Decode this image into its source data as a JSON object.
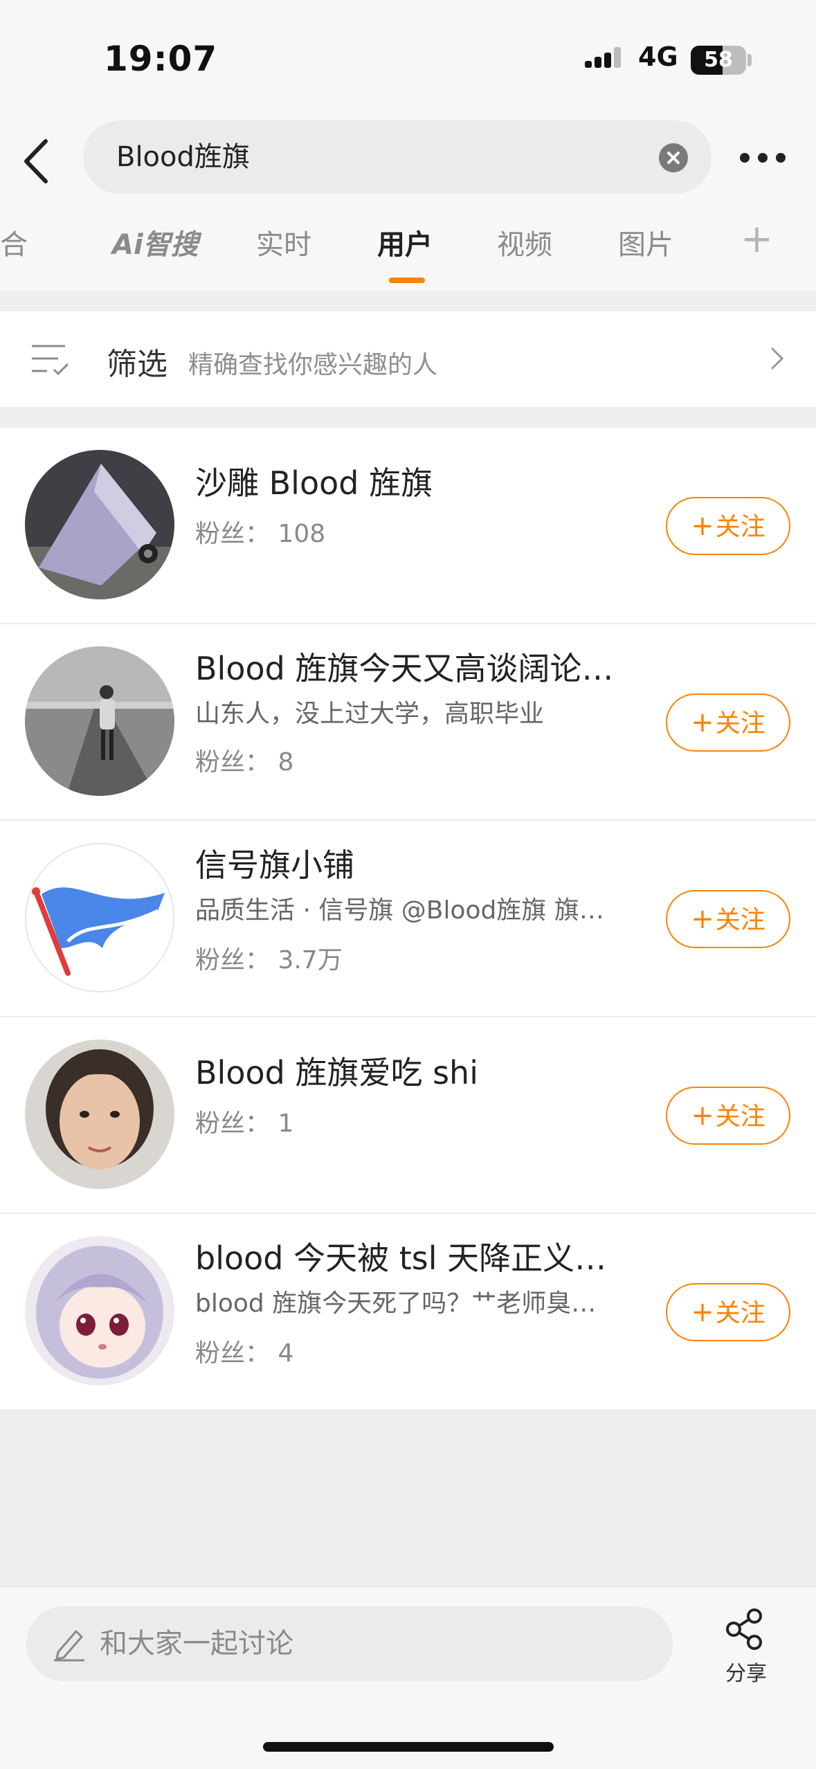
{
  "status_bar": {
    "time": "19:07",
    "network": "4G",
    "battery": "58",
    "battery_level": 0.58
  },
  "search": {
    "query": "Blood旌旗"
  },
  "tabs": [
    {
      "label": "综合",
      "active": false
    },
    {
      "label": "Ai智搜",
      "active": false
    },
    {
      "label": "实时",
      "active": false
    },
    {
      "label": "用户",
      "active": true
    },
    {
      "label": "视频",
      "active": false
    },
    {
      "label": "图片",
      "active": false
    }
  ],
  "tab_add": "+",
  "filter": {
    "label": "筛选",
    "hint": "精确查找你感兴趣的人"
  },
  "users": [
    {
      "name": "沙雕 Blood 旌旗",
      "desc": "",
      "fans": "粉丝： 108",
      "follow": "关注"
    },
    {
      "name": "Blood 旌旗今天又高谈阔论…",
      "desc": "山东人，没上过大学，高职毕业",
      "fans": "粉丝： 8",
      "follow": "关注"
    },
    {
      "name": "信号旗小铺",
      "desc": "品质生活 · 信号旗 @Blood旌旗 旗…",
      "fans": "粉丝： 3.7万",
      "follow": "关注"
    },
    {
      "name": "Blood 旌旗爱吃 shi",
      "desc": "",
      "fans": "粉丝： 1",
      "follow": "关注"
    },
    {
      "name": "blood 今天被 tsl 天降正义了吗",
      "desc": "blood 旌旗今天死了吗？艹老师臭…",
      "fans": "粉丝： 4",
      "follow": "关注"
    }
  ],
  "bottom_bar": {
    "comment_placeholder": "和大家一起讨论",
    "share_label": "分享"
  },
  "colors": {
    "accent": "#ff8200",
    "background": "#f7f7f7"
  }
}
